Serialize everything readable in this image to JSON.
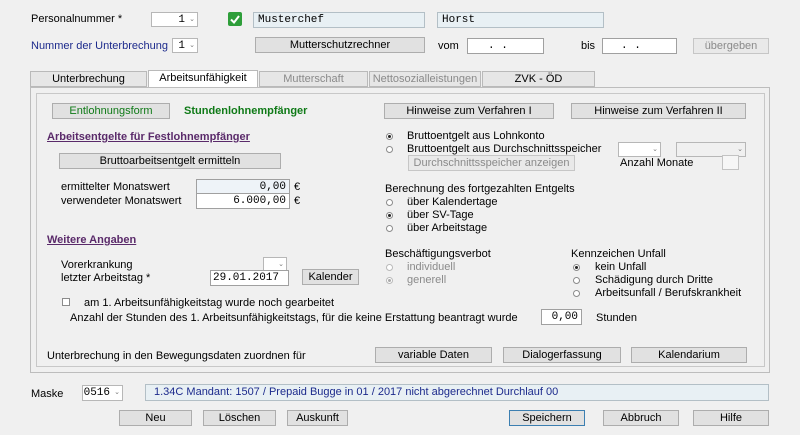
{
  "header": {
    "personalnummer_label": "Personalnummer *",
    "personalnummer_value": "1",
    "name_last": "Musterchef",
    "name_first": "Horst",
    "unterbrechung_label": "Nummer der Unterbrechung",
    "unterbrechung_value": "1",
    "mutterschutzrechner_label": "Mutterschutzrechner",
    "vom_label": "vom",
    "vom_value": ".      .",
    "bis_label": "bis",
    "bis_value": ".      .",
    "uebergeben_label": "übergeben"
  },
  "tabs": [
    {
      "label": "Unterbrechung",
      "state": "normal"
    },
    {
      "label": "Arbeitsunfähigkeit",
      "state": "active"
    },
    {
      "label": "Mutterschaft",
      "state": "disabled"
    },
    {
      "label": "Nettosozialleistungen",
      "state": "disabled"
    },
    {
      "label": "ZVK - ÖD",
      "state": "normal"
    }
  ],
  "main": {
    "entlohnungsform_button": "Entlohnungsform",
    "entlohnungsform_value": "Stundenlohnempfänger",
    "hinweise_1": "Hinweise zum Verfahren I",
    "hinweise_2": "Hinweise zum Verfahren II",
    "section_arbeitsentgelte": "Arbeitsentgelte für Festlohnempfänger",
    "bruttoarbeitsentgelt_button": "Bruttoarbeitsentgelt ermitteln",
    "ermittelter_label": "ermittelter Monatswert",
    "ermittelter_value": "0,00",
    "verwendeter_label": "verwendeter Monatswert",
    "verwendeter_value": "6.000,00",
    "currency": "€",
    "brutto_lohnkonto": "Bruttoentgelt aus Lohnkonto",
    "brutto_durchschnitt": "Bruttoentgelt aus Durchschnittsspeicher",
    "durchschnitt_button": "Durchschnittsspeicher anzeigen",
    "anzahl_monate_label": "Anzahl Monate",
    "berechnung_label": "Berechnung des fortgezahlten Entgelts",
    "berechnung_options": [
      "über Kalendertage",
      "über SV-Tage",
      "über Arbeitstage"
    ],
    "section_weitere": "Weitere Angaben",
    "vorerkrankung_label": "Vorerkrankung",
    "letzter_arbeitstag_label": "letzter Arbeitstag *",
    "letzter_arbeitstag_value": "29.01.2017",
    "kalender_button": "Kalender",
    "beschaeftigungsverbot_label": "Beschäftigungsverbot",
    "beschaeftigungsverbot_options": [
      "individuell",
      "generell"
    ],
    "kennzeichen_label": "Kennzeichen Unfall",
    "kennzeichen_options": [
      "kein Unfall",
      "Schädigung durch Dritte",
      "Arbeitsunfall / Berufskrankheit"
    ],
    "erster_tag_label": "am 1. Arbeitsunfähigkeitstag wurde noch gearbeitet",
    "stunden_label": "Anzahl der Stunden des 1. Arbeitsunfähigkeitstags, für die keine Erstattung beantragt wurde",
    "stunden_value": "0,00",
    "stunden_unit": "Stunden",
    "zuordnen_label": "Unterbrechung in den Bewegungsdaten zuordnen für",
    "variable_daten_button": "variable Daten",
    "dialogerfassung_button": "Dialogerfassung",
    "kalendarium_button": "Kalendarium"
  },
  "footer": {
    "maske_label": "Maske",
    "maske_value": "0516",
    "status_text": "1.34C Mandant: 1507 / Prepaid Bugge in 01 / 2017 nicht abgerechnet   Durchlauf 00",
    "buttons": [
      "Neu",
      "Löschen",
      "Auskunft",
      "Speichern",
      "Abbruch",
      "Hilfe"
    ]
  },
  "colors": {
    "accent_green": "#0f7a17",
    "label_blue": "#1c2a8c",
    "section_purple": "#5a2a6a",
    "checkmark_bg": "#2e9e3a"
  }
}
